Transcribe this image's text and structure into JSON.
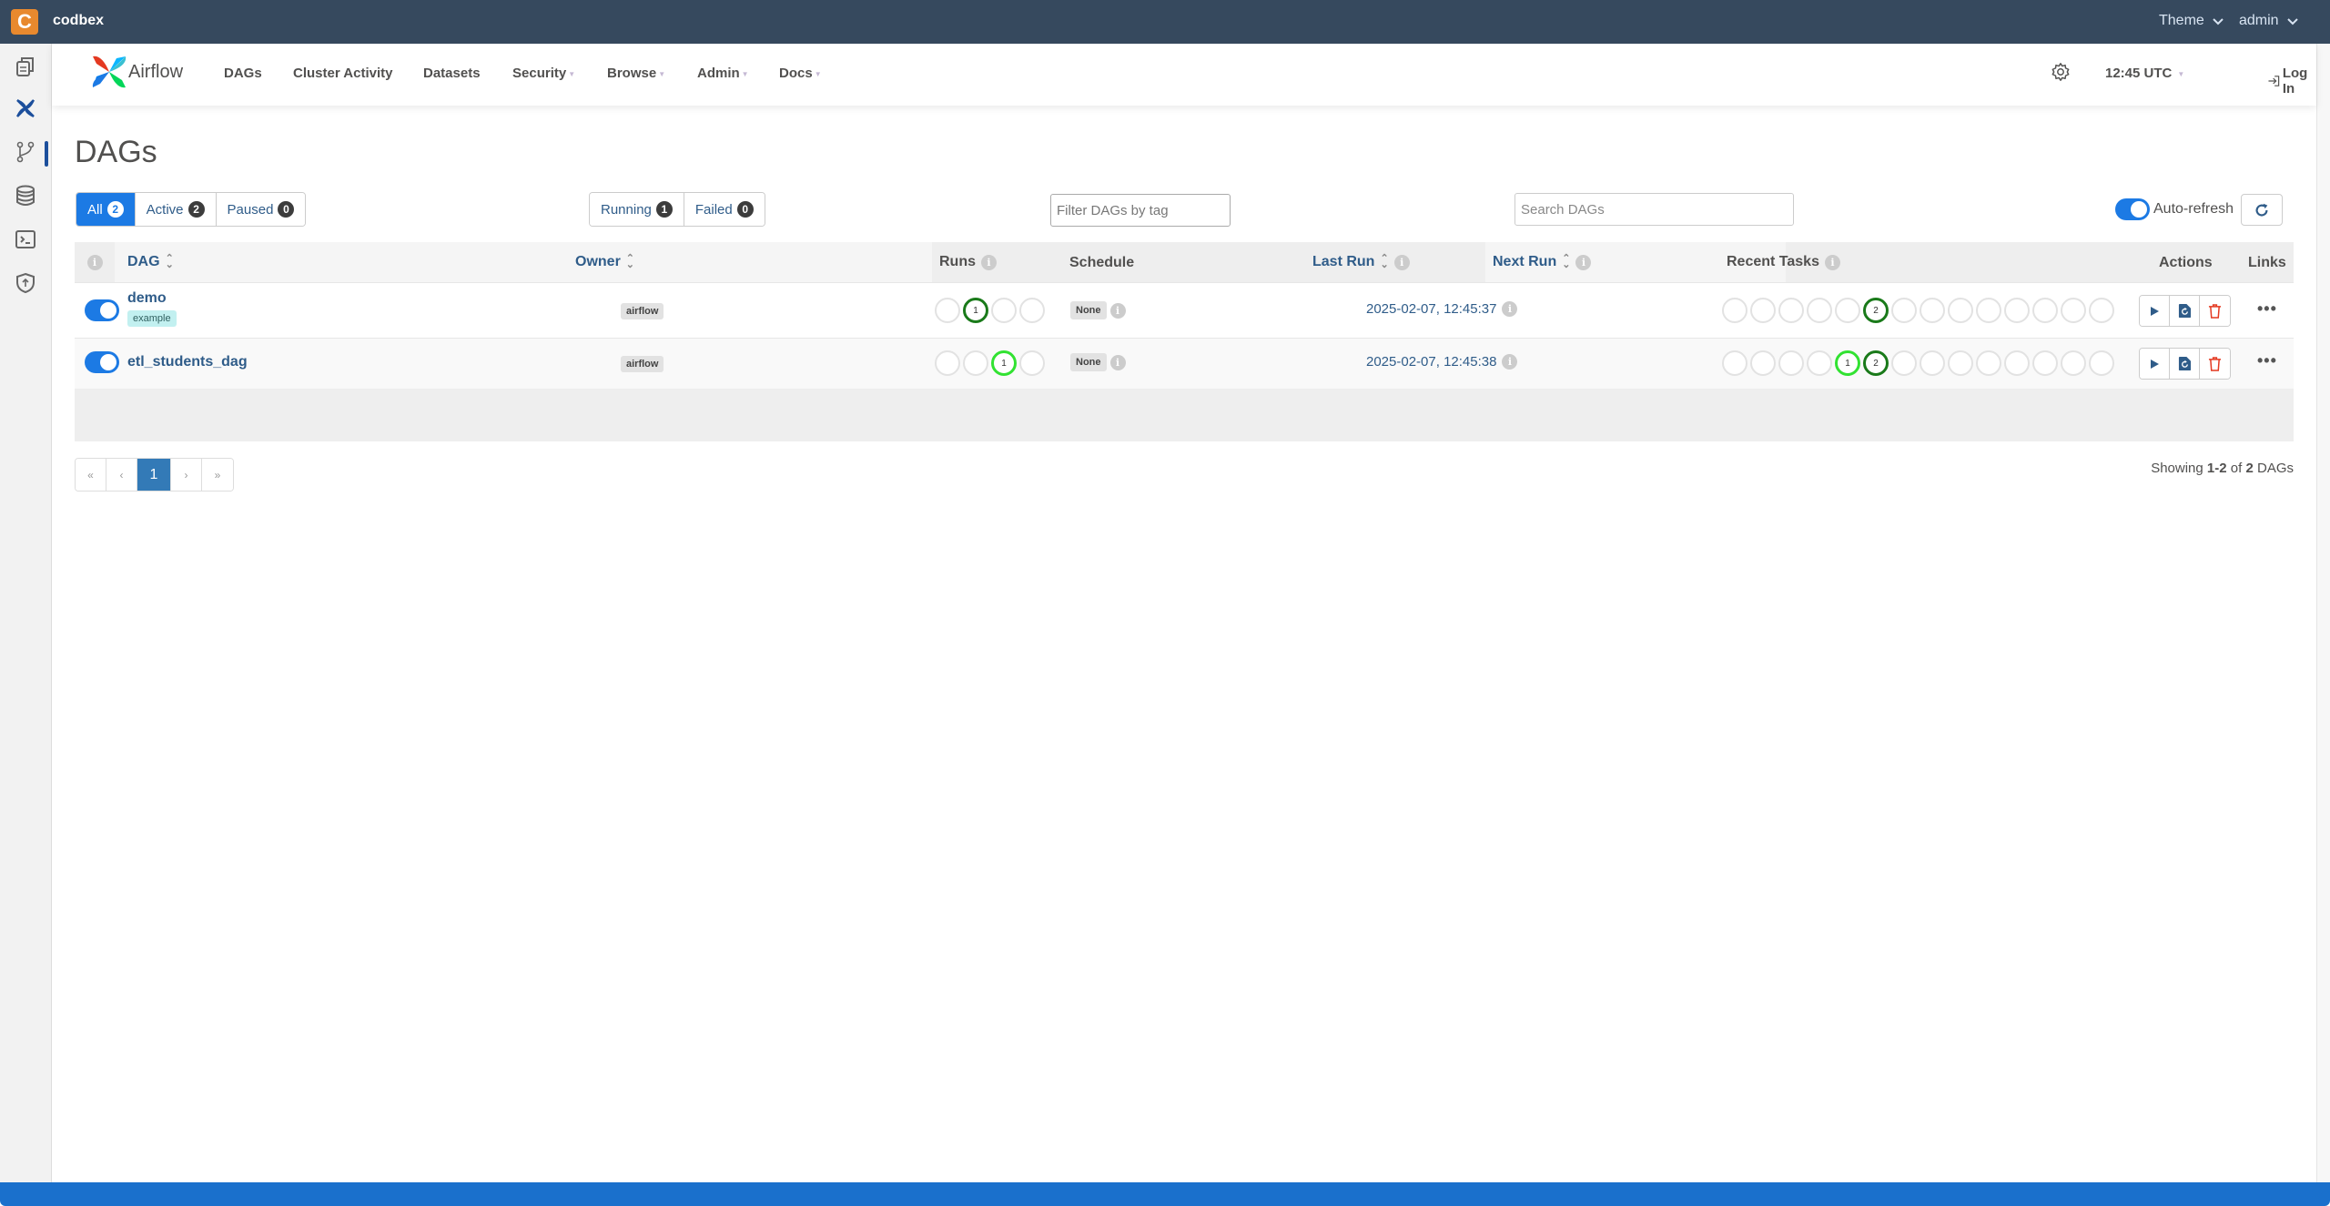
{
  "topbar": {
    "brand_letter": "C",
    "brand_name": "codbex",
    "theme_label": "Theme",
    "user_label": "admin"
  },
  "leftbar": {
    "items": [
      {
        "icon": "documents-icon"
      },
      {
        "icon": "airflow-icon",
        "active": true
      },
      {
        "icon": "git-branch-icon"
      },
      {
        "icon": "database-icon"
      },
      {
        "icon": "terminal-icon"
      },
      {
        "icon": "shield-icon"
      }
    ]
  },
  "navbar": {
    "logo_text": "Airflow",
    "items": [
      {
        "label": "DAGs",
        "dropdown": false
      },
      {
        "label": "Cluster Activity",
        "dropdown": false
      },
      {
        "label": "Datasets",
        "dropdown": false
      },
      {
        "label": "Security",
        "dropdown": true
      },
      {
        "label": "Browse",
        "dropdown": true
      },
      {
        "label": "Admin",
        "dropdown": true
      },
      {
        "label": "Docs",
        "dropdown": true
      }
    ],
    "clock": "12:45 UTC",
    "login_label": "Log In"
  },
  "page": {
    "title": "DAGs"
  },
  "filters": {
    "status": [
      {
        "label": "All",
        "count": "2",
        "active": true
      },
      {
        "label": "Active",
        "count": "2",
        "active": false
      },
      {
        "label": "Paused",
        "count": "0",
        "active": false
      }
    ],
    "run_state": [
      {
        "label": "Running",
        "count": "1"
      },
      {
        "label": "Failed",
        "count": "0"
      }
    ],
    "tag_placeholder": "Filter DAGs by tag",
    "search_placeholder": "Search DAGs",
    "autorefresh_label": "Auto-refresh",
    "autorefresh_on": true
  },
  "table": {
    "headers": {
      "dag": "DAG",
      "owner": "Owner",
      "runs": "Runs",
      "schedule": "Schedule",
      "last_run": "Last Run",
      "next_run": "Next Run",
      "recent_tasks": "Recent Tasks",
      "actions": "Actions",
      "links": "Links"
    },
    "rows": [
      {
        "name": "demo",
        "tag": "example",
        "enabled": true,
        "owner": "airflow",
        "runs": [
          {
            "state": "none",
            "count": ""
          },
          {
            "state": "success",
            "count": "1"
          },
          {
            "state": "none",
            "count": ""
          },
          {
            "state": "none",
            "count": ""
          }
        ],
        "schedule": "None",
        "last_run": "2025-02-07, 12:45:37",
        "next_run": "",
        "recent_tasks": [
          {
            "state": "none",
            "count": ""
          },
          {
            "state": "none",
            "count": ""
          },
          {
            "state": "none",
            "count": ""
          },
          {
            "state": "none",
            "count": ""
          },
          {
            "state": "none",
            "count": ""
          },
          {
            "state": "success",
            "count": "2"
          },
          {
            "state": "none",
            "count": ""
          },
          {
            "state": "none",
            "count": ""
          },
          {
            "state": "none",
            "count": ""
          },
          {
            "state": "none",
            "count": ""
          },
          {
            "state": "none",
            "count": ""
          },
          {
            "state": "none",
            "count": ""
          },
          {
            "state": "none",
            "count": ""
          },
          {
            "state": "none",
            "count": ""
          }
        ],
        "links_label": "•••"
      },
      {
        "name": "etl_students_dag",
        "tag": "",
        "enabled": true,
        "owner": "airflow",
        "runs": [
          {
            "state": "none",
            "count": ""
          },
          {
            "state": "none",
            "count": ""
          },
          {
            "state": "running",
            "count": "1"
          },
          {
            "state": "none",
            "count": ""
          }
        ],
        "schedule": "None",
        "last_run": "2025-02-07, 12:45:38",
        "next_run": "",
        "recent_tasks": [
          {
            "state": "none",
            "count": ""
          },
          {
            "state": "none",
            "count": ""
          },
          {
            "state": "none",
            "count": ""
          },
          {
            "state": "none",
            "count": ""
          },
          {
            "state": "running",
            "count": "1"
          },
          {
            "state": "success",
            "count": "2"
          },
          {
            "state": "none",
            "count": ""
          },
          {
            "state": "none",
            "count": ""
          },
          {
            "state": "none",
            "count": ""
          },
          {
            "state": "none",
            "count": ""
          },
          {
            "state": "none",
            "count": ""
          },
          {
            "state": "none",
            "count": ""
          },
          {
            "state": "none",
            "count": ""
          },
          {
            "state": "none",
            "count": ""
          }
        ],
        "links_label": "•••"
      }
    ]
  },
  "pagination": {
    "first": "«",
    "prev": "‹",
    "current": "1",
    "next": "›",
    "last": "»"
  },
  "summary": {
    "prefix": "Showing",
    "range": "1-2",
    "of": "of",
    "total": "2",
    "suffix": "DAGs"
  },
  "colors": {
    "topbar": "#36495e",
    "accent": "#1c7ae4",
    "success": "#1a7a1a",
    "running": "#32e232",
    "delete": "#e43921",
    "bottombar": "#1a70cc"
  }
}
